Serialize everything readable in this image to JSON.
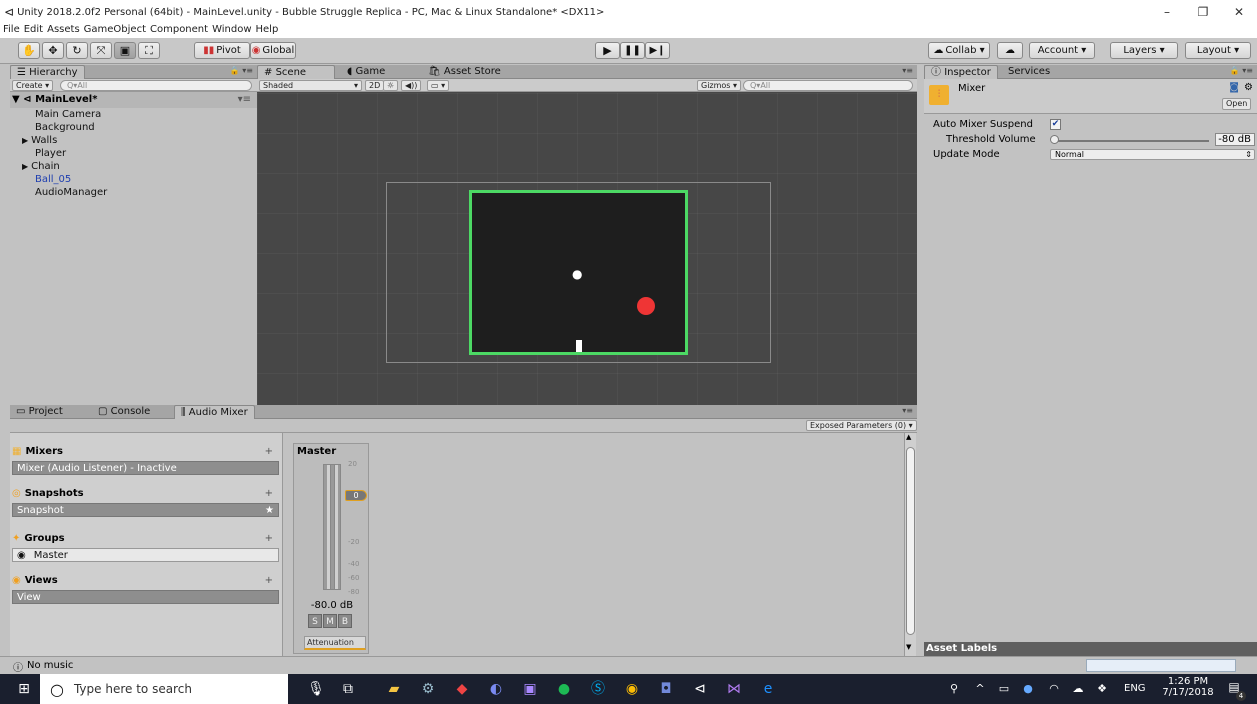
{
  "window": {
    "title": "Unity 2018.2.0f2 Personal (64bit) - MainLevel.unity - Bubble Struggle Replica - PC, Mac & Linux Standalone* <DX11>",
    "controls": [
      "–",
      "❐",
      "✕"
    ]
  },
  "menu": [
    "File",
    "Edit",
    "Assets",
    "GameObject",
    "Component",
    "Window",
    "Help"
  ],
  "toolbar": {
    "pivot": "Pivot",
    "global": "Global",
    "collab": "Collab ▾",
    "account": "Account ▾",
    "layers": "Layers ▾",
    "layout": "Layout ▾"
  },
  "hierarchy": {
    "tab": "Hierarchy",
    "create": "Create ▾",
    "search_placeholder": "Q▾All",
    "scene": "MainLevel*",
    "items": [
      {
        "label": "Main Camera",
        "arrow": ""
      },
      {
        "label": "Background",
        "arrow": ""
      },
      {
        "label": "Walls",
        "arrow": "▶"
      },
      {
        "label": "Player",
        "arrow": ""
      },
      {
        "label": "Chain",
        "arrow": "▶"
      },
      {
        "label": "Ball_05",
        "arrow": "",
        "color": "#1f3fb0"
      },
      {
        "label": "AudioManager",
        "arrow": ""
      }
    ]
  },
  "scene_view": {
    "tabs": [
      "Scene",
      "Game",
      "Asset Store"
    ],
    "shaded": "Shaded",
    "mode2d": "2D",
    "gizmos": "Gizmos ▾",
    "search_placeholder": "Q▾All",
    "border_color": "#4cd964",
    "ball_color": "#ef3535"
  },
  "inspector": {
    "tabs": [
      "Inspector",
      "Services"
    ],
    "object_name": "Mixer",
    "open_button": "Open",
    "auto_mixer_suspend_label": "Auto Mixer Suspend",
    "auto_mixer_suspend_checked": true,
    "threshold_label": "Threshold Volume",
    "threshold_value": "-80 dB",
    "update_mode_label": "Update Mode",
    "update_mode_value": "Normal",
    "asset_labels": "Asset Labels"
  },
  "bottom": {
    "tabs": [
      "Project",
      "Console",
      "Audio Mixer"
    ],
    "exposed_params": "Exposed Parameters (0) ▾",
    "mixers_label": "Mixers",
    "mixer_row": "Mixer  (Audio Listener) - Inactive",
    "snapshots_label": "Snapshots",
    "snapshot_row": "Snapshot",
    "groups_label": "Groups",
    "group_row": "Master",
    "views_label": "Views",
    "view_row": "View",
    "strip_name": "Master",
    "strip_db": "-80.0 dB",
    "strip_marker": "0",
    "strip_buttons": [
      "S",
      "M",
      "B"
    ],
    "attenuation": "Attenuation",
    "scale_labels": [
      "20",
      "0",
      "-20",
      "-40",
      "-60",
      "-80"
    ]
  },
  "status": "No music",
  "taskbar": {
    "search_placeholder": "Type here to search",
    "lang": "ENG",
    "time": "1:26 PM",
    "date": "7/17/2018",
    "notifications": "4"
  }
}
